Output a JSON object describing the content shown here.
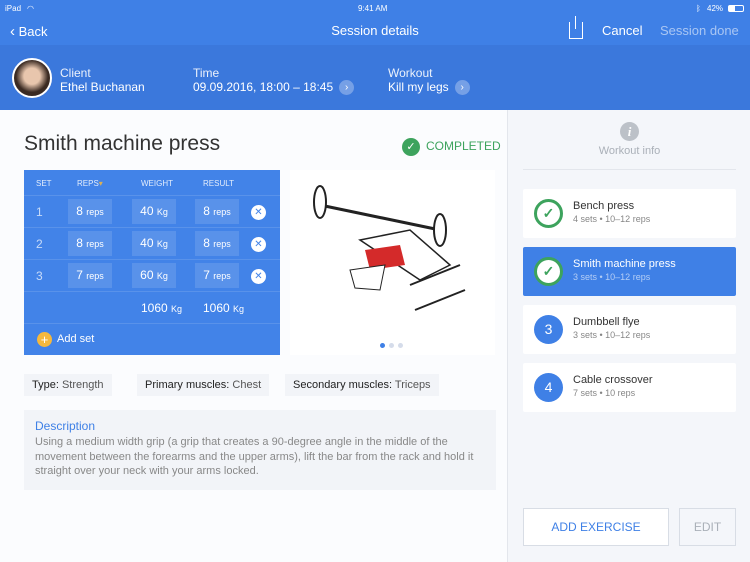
{
  "status": {
    "device": "iPad",
    "time": "9:41 AM",
    "battery": "42%"
  },
  "nav": {
    "back": "Back",
    "title": "Session details",
    "cancel": "Cancel",
    "done": "Session done"
  },
  "header": {
    "client_label": "Client",
    "client": "Ethel Buchanan",
    "time_label": "Time",
    "time": "09.09.2016, 18:00 – 18:45",
    "workout_label": "Workout",
    "workout": "Kill my legs"
  },
  "exercise": {
    "title": "Smith machine press",
    "status": "COMPLETED"
  },
  "table": {
    "headers": [
      "SET",
      "REPS",
      "WEIGHT",
      "RESULT"
    ],
    "rows": [
      {
        "set": "1",
        "reps": "8",
        "weight": "40",
        "result": "8"
      },
      {
        "set": "2",
        "reps": "8",
        "weight": "40",
        "result": "8"
      },
      {
        "set": "3",
        "reps": "7",
        "weight": "60",
        "result": "7"
      }
    ],
    "reps_unit": "reps",
    "weight_unit": "Kg",
    "total_weight": "1060",
    "total_result": "1060",
    "add_set": "Add set"
  },
  "tags": [
    {
      "k": "Type:",
      "v": "Strength"
    },
    {
      "k": "Primary muscles:",
      "v": "Chest"
    },
    {
      "k": "Secondary muscles:",
      "v": "Triceps"
    }
  ],
  "description": {
    "title": "Description",
    "text": "Using a medium width grip (a grip that creates a 90-degree angle in the middle of the movement between the forearms and the upper arms), lift the bar from the rack and hold it straight over your neck with your arms locked."
  },
  "sidebar": {
    "info": "Workout info",
    "items": [
      {
        "name": "Bench press",
        "sub": "4 sets • 10–12 reps",
        "badge": "✓"
      },
      {
        "name": "Smith machine press",
        "sub": "3 sets • 10–12 reps",
        "badge": "✓"
      },
      {
        "name": "Dumbbell flye",
        "sub": "3 sets • 10–12 reps",
        "badge": "3"
      },
      {
        "name": "Cable crossover",
        "sub": "7 sets • 10 reps",
        "badge": "4"
      }
    ],
    "add": "ADD EXERCISE",
    "edit": "EDIT"
  }
}
